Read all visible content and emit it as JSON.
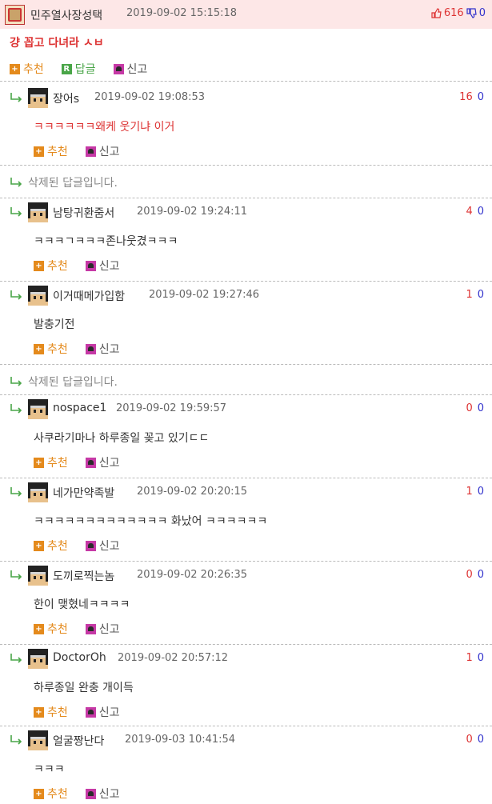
{
  "post": {
    "author": "민주열사장성택",
    "time": "2019-09-02 15:15:18",
    "upvotes": "616",
    "downvotes": "0",
    "title": "걍 꼽고 다녀라 ㅅㅂ",
    "actions": {
      "recommend": "추천",
      "reply": "답글",
      "report": "신고"
    }
  },
  "comment_actions": {
    "recommend": "추천",
    "report": "신고"
  },
  "comments": [
    {
      "author": "장어s",
      "time": "2019-09-02 19:08:53",
      "up": "16",
      "down": "0",
      "text": "ㅋㅋㅋㅋㅋㅋ왜케 웃기냐 이거"
    },
    {
      "deleted": "삭제된 답글입니다."
    },
    {
      "author": "남탕귀환줌서",
      "time": "2019-09-02 19:24:11",
      "up": "4",
      "down": "0",
      "text": "ㅋㅋㅋㄱㅋㅋㅋ존나웃겼ㅋㅋㅋ"
    },
    {
      "author": "이거때메가입함",
      "time": "2019-09-02 19:27:46",
      "up": "1",
      "down": "0",
      "text": "발충기전"
    },
    {
      "deleted": "삭제된 답글입니다."
    },
    {
      "author": "nospace1",
      "time": "2019-09-02 19:59:57",
      "up": "0",
      "down": "0",
      "text": "사쿠라기마나 하루종일 꽂고 있기ㄷㄷ"
    },
    {
      "author": "네가만약족발",
      "time": "2019-09-02 20:20:15",
      "up": "1",
      "down": "0",
      "text": "ㅋㅋㅋㅋㅋㅋㅋㅋㅋㅋㅋㅋㅋ 화났어 ㅋㅋㅋㅋㅋㅋ"
    },
    {
      "author": "도끼로찍는놈",
      "time": "2019-09-02 20:26:35",
      "up": "0",
      "down": "0",
      "text": "한이 맺혔네ㅋㅋㅋㅋ"
    },
    {
      "author": "DoctorOh",
      "time": "2019-09-02 20:57:12",
      "up": "1",
      "down": "0",
      "text": "하루종일 완충 개이득"
    },
    {
      "author": "얼굴짱난다",
      "time": "2019-09-03 10:41:54",
      "up": "0",
      "down": "0",
      "text": "ㅋㅋㅋ"
    }
  ],
  "colors": {
    "accent_red": "#dd3333",
    "accent_blue": "#3333cc",
    "recommend_orange": "#e48a1c",
    "reply_green": "#49a548",
    "header_bg": "#fde7e7"
  }
}
